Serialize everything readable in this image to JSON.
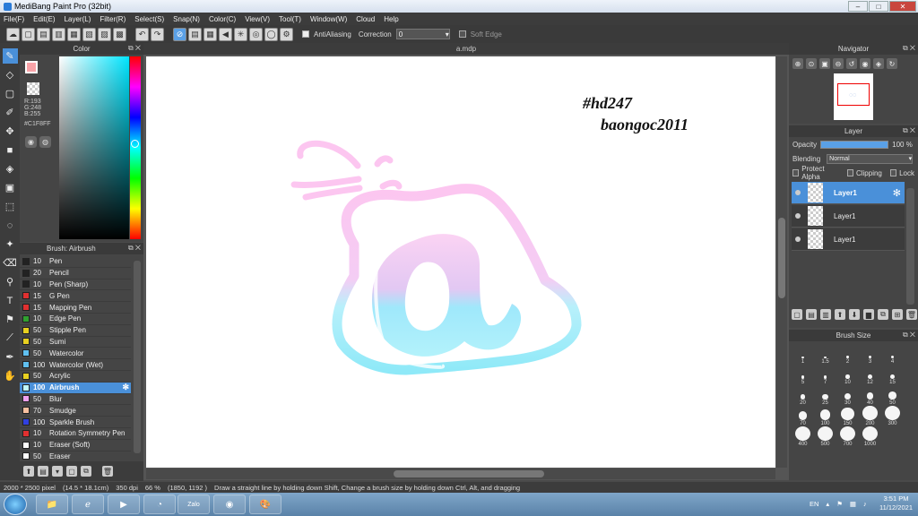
{
  "window": {
    "title": "MediBang Paint Pro (32bit)",
    "min": "–",
    "max": "□",
    "close": "✕"
  },
  "menu": [
    "File(F)",
    "Edit(E)",
    "Layer(L)",
    "Filter(R)",
    "Select(S)",
    "Snap(N)",
    "Color(C)",
    "View(V)",
    "Tool(T)",
    "Window(W)",
    "Cloud",
    "Help"
  ],
  "toolbar": {
    "antialiasing": "AntiAliasing",
    "correction_label": "Correction",
    "correction_value": "0",
    "soft_edge": "Soft Edge"
  },
  "color_panel": {
    "title": "Color",
    "r": "R:193",
    "g": "G:248",
    "b": "B:255",
    "hex": "#C1F8FF",
    "fg_color": "#f9a3a8",
    "hue_color": "#00e5ff"
  },
  "brush_panel": {
    "title": "Brush: Airbrush",
    "brushes": [
      {
        "size": "10",
        "name": "Pen",
        "color": "#222222"
      },
      {
        "size": "20",
        "name": "Pencil",
        "color": "#222222"
      },
      {
        "size": "10",
        "name": "Pen (Sharp)",
        "color": "#222222"
      },
      {
        "size": "15",
        "name": "G Pen",
        "color": "#e03030"
      },
      {
        "size": "15",
        "name": "Mapping Pen",
        "color": "#e03030"
      },
      {
        "size": "10",
        "name": "Edge Pen",
        "color": "#30a030"
      },
      {
        "size": "50",
        "name": "Stipple Pen",
        "color": "#e8d020"
      },
      {
        "size": "50",
        "name": "Sumi",
        "color": "#e8d020"
      },
      {
        "size": "50",
        "name": "Watercolor",
        "color": "#60c0f0"
      },
      {
        "size": "100",
        "name": "Watercolor (Wet)",
        "color": "#60c0f0"
      },
      {
        "size": "50",
        "name": "Acrylic",
        "color": "#e8d020"
      },
      {
        "size": "100",
        "name": "Airbrush",
        "color": "#c1f8ff"
      },
      {
        "size": "50",
        "name": "Blur",
        "color": "#f0a0f0"
      },
      {
        "size": "70",
        "name": "Smudge",
        "color": "#f8c0a0"
      },
      {
        "size": "100",
        "name": "Sparkle Brush",
        "color": "#3040e0"
      },
      {
        "size": "10",
        "name": "Rotation Symmetry Pen",
        "color": "#e03030"
      },
      {
        "size": "10",
        "name": "Eraser (Soft)",
        "color": "#ffffff"
      },
      {
        "size": "50",
        "name": "Eraser",
        "color": "#ffffff"
      }
    ]
  },
  "canvas": {
    "tab": "a.mdp",
    "watermark1": "#hd247",
    "watermark2": "baongoc2011"
  },
  "navigator": {
    "title": "Navigator"
  },
  "layer_panel": {
    "title": "Layer",
    "opacity_label": "Opacity",
    "opacity_value": "100 %",
    "opacity_level": 1.0,
    "blending_label": "Blending",
    "blending_value": "Normal",
    "protect_alpha": "Protect Alpha",
    "clipping": "Clipping",
    "lock": "Lock",
    "layers": [
      "Layer1",
      "Layer1",
      "Layer1"
    ]
  },
  "brush_size_panel": {
    "title": "Brush Size",
    "sizes": [
      "1",
      "1.5",
      "2",
      "3",
      "4",
      "5",
      "7",
      "10",
      "12",
      "15",
      "20",
      "25",
      "30",
      "40",
      "50",
      "70",
      "100",
      "150",
      "200",
      "300",
      "400",
      "500",
      "700",
      "1000"
    ]
  },
  "status": {
    "size": "2000 * 2500 pixel",
    "cm": "(14.5 * 18.1cm)",
    "dpi": "350 dpi",
    "zoom": "66 %",
    "coords": "(1850, 1192 )",
    "hint": "Draw a straight line by holding down Shift, Change a brush size by holding down Ctrl, Alt, and dragging"
  },
  "taskbar": {
    "lang": "EN",
    "time": "3:51 PM",
    "date": "11/12/2021",
    "zalo": "Zalo"
  }
}
